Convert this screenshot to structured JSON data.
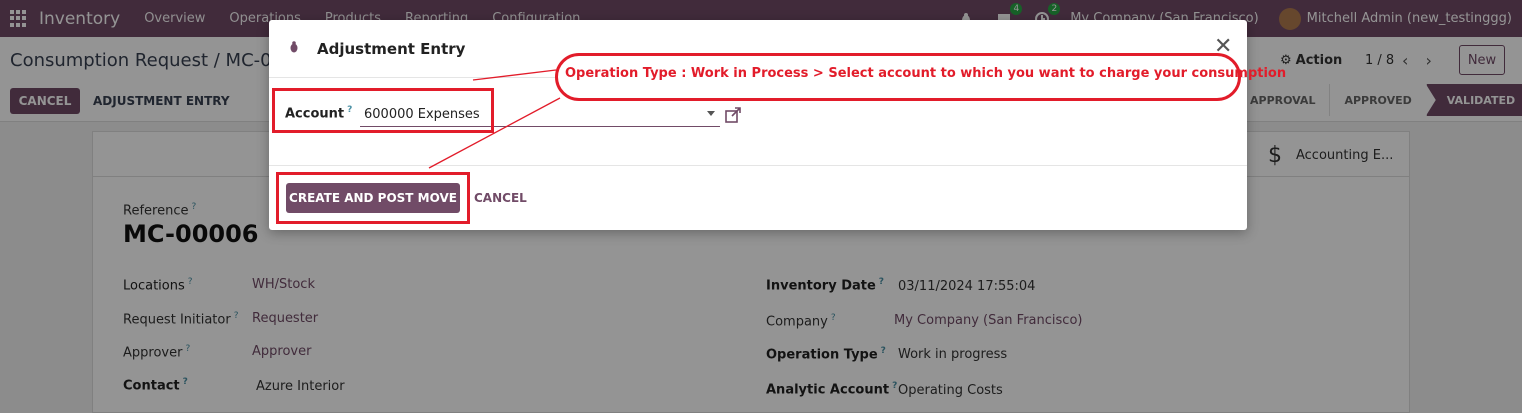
{
  "navbar": {
    "app_name": "Inventory",
    "menu": [
      "Overview",
      "Operations",
      "Products",
      "Reporting",
      "Configuration"
    ],
    "chat_count": "4",
    "activity_count": "2",
    "company": "My Company (San Francisco)",
    "user": "Mitchell Admin (new_testinggg)"
  },
  "control": {
    "breadcrumb": "Consumption Request / MC-000",
    "action_label": "Action",
    "pager": "1 / 8",
    "new_label": "New",
    "cancel_label": "CANCEL",
    "adjustment_label": "ADJUSTMENT ENTRY",
    "steps": [
      "APPROVAL",
      "APPROVED",
      "VALIDATED"
    ]
  },
  "sheet": {
    "stat_label": "Accounting E...",
    "reference_label": "Reference",
    "reference_value": "MC-00006",
    "locations_label": "Locations",
    "locations_value": "WH/Stock",
    "initiator_label": "Request Initiator",
    "initiator_value": "Requester",
    "approver_label": "Approver",
    "approver_value": "Approver",
    "contact_label": "Contact",
    "contact_value": "Azure Interior",
    "inventory_date_label": "Inventory Date",
    "inventory_date_value": "03/11/2024 17:55:04",
    "company_label": "Company",
    "company_value": "My Company (San Francisco)",
    "operation_type_label": "Operation Type",
    "operation_type_value": "Work in progress",
    "analytic_label": "Analytic Account",
    "analytic_value": "Operating Costs"
  },
  "dialog": {
    "title": "Adjustment Entry",
    "close_symbol": "✕",
    "account_label": "Account",
    "account_value": "600000 Expenses",
    "primary_label": "CREATE AND POST MOVE",
    "cancel_label": "CANCEL"
  },
  "annotation": {
    "text": "Operation Type : Work in Process > Select account to which you want to charge your consumption",
    "color": "#e21c2a"
  },
  "colors": {
    "brand": "#714b67",
    "badge": "#28a745"
  }
}
